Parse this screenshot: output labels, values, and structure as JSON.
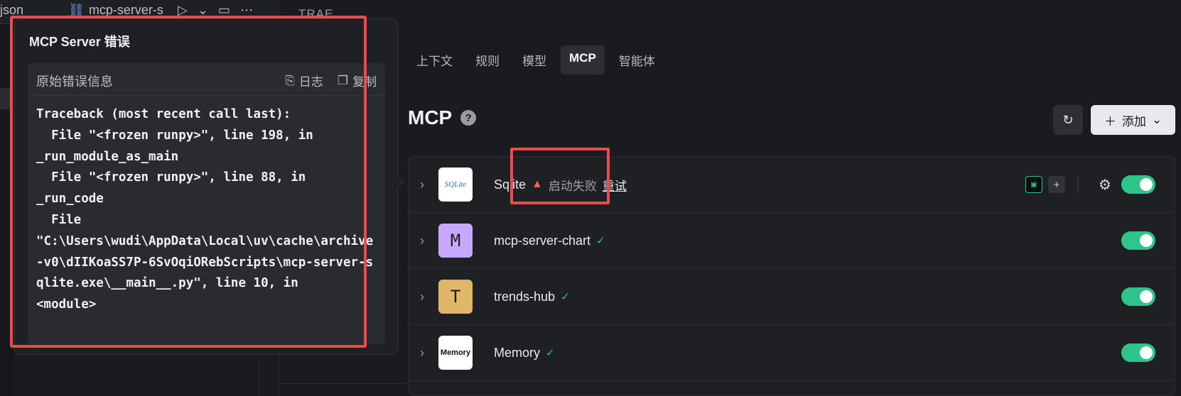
{
  "editor": {
    "tab_json": "json",
    "tab_mcp": "mcp-server-s",
    "panel_title": "TRAE"
  },
  "nav_tabs": [
    {
      "label": "上下文"
    },
    {
      "label": "规则"
    },
    {
      "label": "模型"
    },
    {
      "label": "MCP",
      "active": true
    },
    {
      "label": "智能体"
    }
  ],
  "mcp": {
    "title": "MCP",
    "help": "?",
    "add_label": "添加"
  },
  "servers": [
    {
      "name": "Sqlite",
      "logo_text": "SQLite",
      "status": "启动失败",
      "retry": "重试",
      "enabled": true
    },
    {
      "name": "mcp-server-chart",
      "logo_text": "M",
      "status": "ok",
      "enabled": true
    },
    {
      "name": "trends-hub",
      "logo_text": "T",
      "status": "ok",
      "enabled": true
    },
    {
      "name": "Memory",
      "logo_text": "Memory",
      "status": "ok",
      "enabled": true
    }
  ],
  "popup": {
    "title": "MCP Server 错误",
    "card_label": "原始错误信息",
    "log_label": "日志",
    "copy_label": "复制",
    "traceback": "Traceback (most recent call last):\n  File \"<frozen runpy>\", line 198, in\n_run_module_as_main\n  File \"<frozen runpy>\", line 88, in\n_run_code\n  File\n\"C:\\Users\\wudi\\AppData\\Local\\uv\\cache\\archive-v0\\dIIKoaSS7P-6SvOqiORebScripts\\mcp-server-sqlite.exe\\__main__.py\", line 10, in\n<module>"
  },
  "colors": {
    "accent_green": "#2cc68a",
    "error_red": "#e84c4f",
    "avatar_purple": "#c7a7ff",
    "avatar_gold": "#e0b668"
  }
}
